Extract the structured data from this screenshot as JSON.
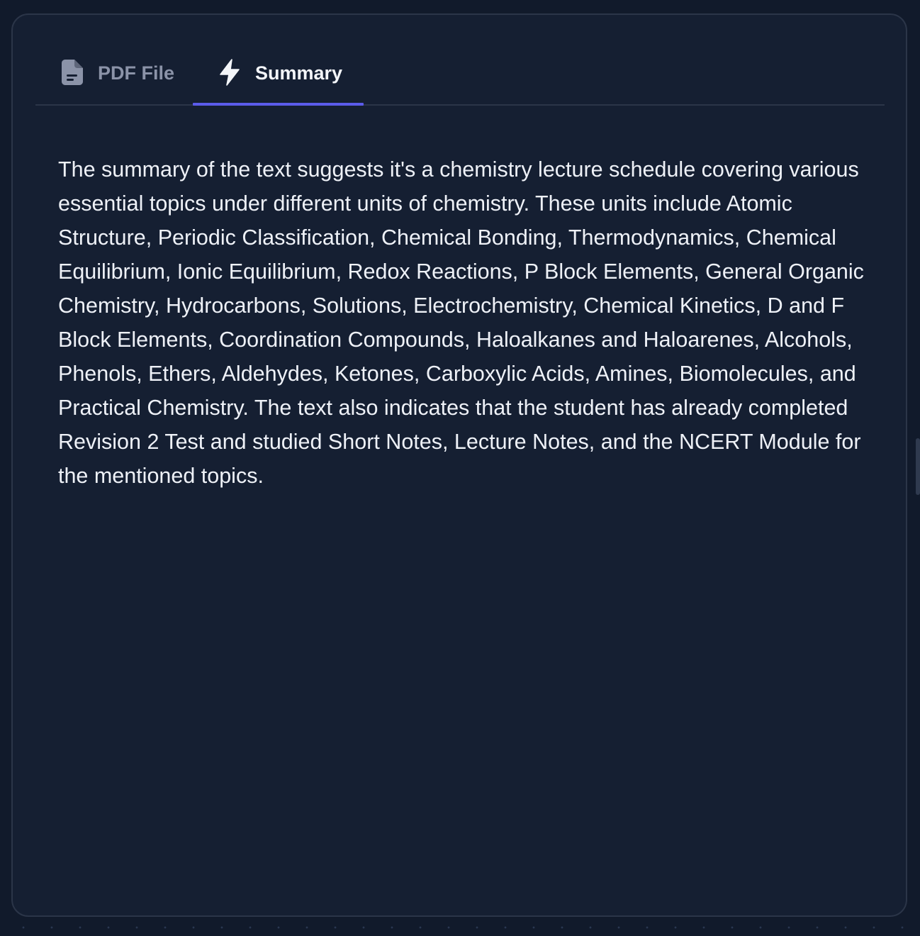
{
  "tabs": [
    {
      "label": "PDF File",
      "icon": "document-icon",
      "active": false
    },
    {
      "label": "Summary",
      "icon": "lightning-icon",
      "active": true
    }
  ],
  "summary": {
    "text": "The summary of the text suggests it's a chemistry lecture schedule covering various essential topics under different units of chemistry. These units include Atomic Structure, Periodic Classification, Chemical Bonding, Thermodynamics, Chemical Equilibrium, Ionic Equilibrium, Redox Reactions, P Block Elements, General Organic Chemistry, Hydrocarbons, Solutions, Electrochemistry, Chemical Kinetics, D and F Block Elements, Coordination Compounds, Haloalkanes and Haloarenes, Alcohols, Phenols, Ethers, Aldehydes, Ketones, Carboxylic Acids, Amines, Biomolecules, and Practical Chemistry. The text also indicates that the student has already completed Revision 2 Test and studied Short Notes, Lecture Notes, and the NCERT Module for the mentioned topics."
  },
  "colors": {
    "background": "#111a2b",
    "card": "#151f32",
    "border": "#2b3548",
    "accent": "#5b5bea",
    "text": "#eef1f7",
    "inactive_tab": "#8b93a8"
  }
}
